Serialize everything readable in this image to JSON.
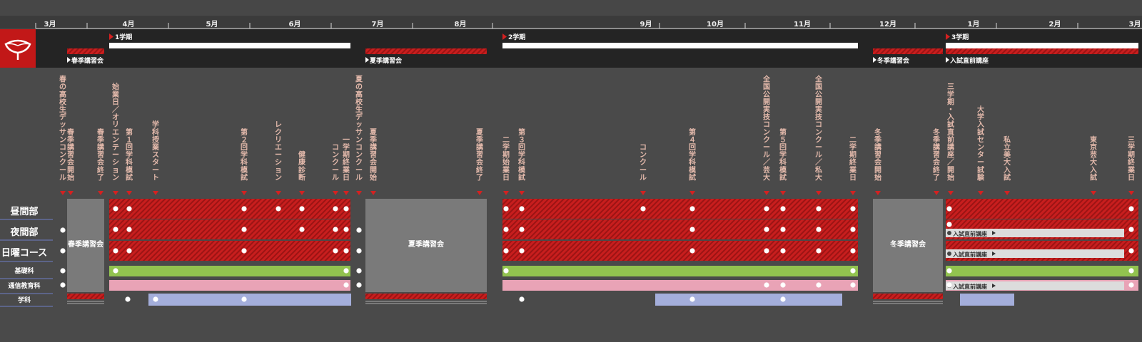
{
  "months": [
    {
      "label": "3月"
    },
    {
      "label": "4月"
    },
    {
      "label": "5月"
    },
    {
      "label": "6月"
    },
    {
      "label": "7月"
    },
    {
      "label": "8月"
    },
    {
      "label": "9月"
    },
    {
      "label": "10月"
    },
    {
      "label": "11月"
    },
    {
      "label": "12月"
    },
    {
      "label": "1月"
    },
    {
      "label": "2月"
    },
    {
      "label": "3月"
    }
  ],
  "terms": [
    {
      "label": "1学期"
    },
    {
      "label": "2学期"
    },
    {
      "label": "3学期"
    }
  ],
  "seasonal": [
    {
      "label": "春季講習会"
    },
    {
      "label": "夏季講習会"
    },
    {
      "label": "冬季講習会"
    },
    {
      "label": "入試直前講座"
    }
  ],
  "row_labels": [
    {
      "label": "昼間部"
    },
    {
      "label": "夜間部"
    },
    {
      "label": "日曜コース"
    },
    {
      "label": "基礎科"
    },
    {
      "label": "通信教育科"
    },
    {
      "label": "学科"
    }
  ],
  "block_labels": [
    {
      "label": "春季講習会"
    },
    {
      "label": "夏季講習会"
    },
    {
      "label": "冬季講習会"
    }
  ],
  "sub_tags": [
    {
      "label": "入試直前講座"
    },
    {
      "label": "入試直前講座"
    },
    {
      "label": "入試直前講座"
    }
  ],
  "events": [
    {
      "label": "春の高校生デッサンコンクール"
    },
    {
      "label": "春季講習会開始"
    },
    {
      "label": "春季講習会終了"
    },
    {
      "label": "始業日／オリエンテーション"
    },
    {
      "label": "第１回学科模試"
    },
    {
      "label": "学科授業スタート"
    },
    {
      "label": "第２回学科模試"
    },
    {
      "label": "レクリエーション"
    },
    {
      "label": "健康診断"
    },
    {
      "label": "コンクール"
    },
    {
      "label": "一学期終業日"
    },
    {
      "label": "夏の高校生デッサンコンクール"
    },
    {
      "label": "夏季講習会開始"
    },
    {
      "label": "夏季講習会終了"
    },
    {
      "label": "二学期始業日"
    },
    {
      "label": "第３回学科模試"
    },
    {
      "label": "コンクール"
    },
    {
      "label": "第４回学科模試"
    },
    {
      "label": "全国公開実技コンクール／芸大"
    },
    {
      "label": "第５回学科模試"
    },
    {
      "label": "全国公開実技コンクール／私大"
    },
    {
      "label": "二学期終業日"
    },
    {
      "label": "冬季講習会開始"
    },
    {
      "label": "冬季講習会終了"
    },
    {
      "label": "三学期・入試直前講座／開始"
    },
    {
      "label": "大学入試センター試験"
    },
    {
      "label": "私立美大入試"
    },
    {
      "label": "東京芸大入試"
    },
    {
      "label": "三学期終業日"
    }
  ],
  "colors": {
    "red": "#c81e1e",
    "red_stripe": "#a01515",
    "gray": "#7a7a7a",
    "green": "#92c34f",
    "pink": "#e9a3b6",
    "lavender": "#a4aedb",
    "event_text": "#e3b9ab",
    "dark_band": "#242424",
    "logo_bg": "#c21818"
  }
}
